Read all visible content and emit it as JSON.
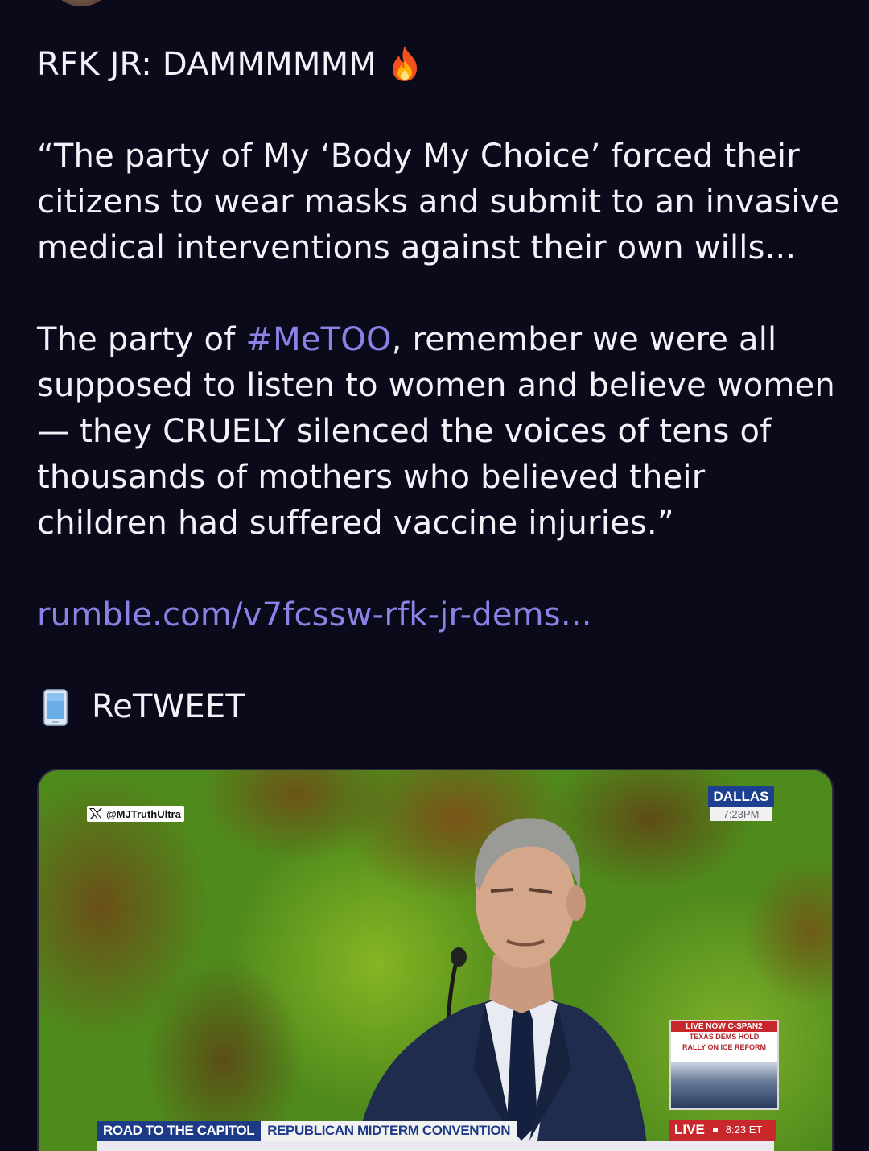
{
  "post": {
    "headline": "RFK JR: DAMMMMMM",
    "headline_emoji": "fire-emoji",
    "quote_line_1": "“The party of My ‘Body My Choice’ forced their",
    "quote_line_2": "citizens to wear masks and submit to an invasive",
    "quote_line_3": "medical interventions against their own wills...",
    "para2_prefix": "The party of ",
    "hashtag": "#MeTOO",
    "para2_suffix": ", remember we were all",
    "para2_line_2": "supposed to listen to women and believe women",
    "para2_line_3": "— they CRUELY silenced the voices of tens of",
    "para2_line_4": "thousands of mothers who believed their",
    "para2_line_5": "children had suffered vaccine injuries.”",
    "link": "rumble.com/v7fcssw-rfk-jr-dems...",
    "retweet_label": "ReTWEET",
    "retweet_emoji": "mobile-phone-emoji"
  },
  "media": {
    "watermark_handle": "@MJTruthUltra",
    "city": "DALLAS",
    "city_time": "7:23PM",
    "inset_label": "LIVE NOW C-SPAN2",
    "inset_headline_1": "TEXAS DEMS HOLD",
    "inset_headline_2": "RALLY ON ICE REFORM",
    "chyron_left": "ROAD TO THE CAPITOL",
    "chyron_right": "REPUBLICAN MIDTERM CONVENTION",
    "live_label": "LIVE",
    "live_time": "8:23 ET"
  },
  "colors": {
    "background": "#0b0a1b",
    "text": "#f2f1f7",
    "link": "#8a83e6"
  }
}
